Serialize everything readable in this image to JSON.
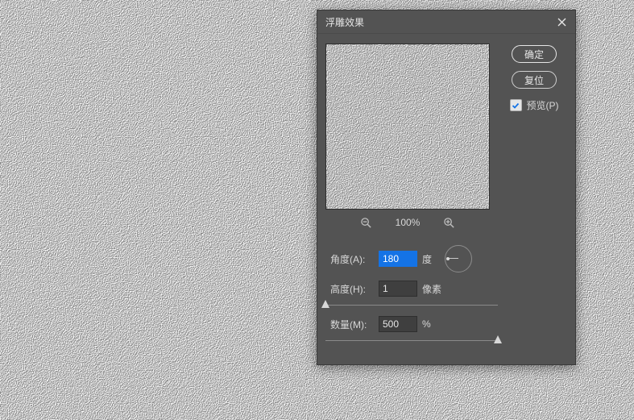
{
  "dialog": {
    "title": "浮雕效果",
    "angle": {
      "label": "角度(A):",
      "value": "180",
      "unit": "度"
    },
    "height": {
      "label": "高度(H):",
      "value": "1",
      "unit": "像素"
    },
    "amount": {
      "label": "数量(M):",
      "value": "500",
      "unit": "%"
    },
    "zoom_level": "100%",
    "buttons": {
      "ok": "确定",
      "reset": "复位"
    },
    "preview_checkbox": {
      "label": "预览(P)",
      "checked": true
    }
  },
  "colors": {
    "accent": "#1473e6",
    "panel": "#535353"
  }
}
